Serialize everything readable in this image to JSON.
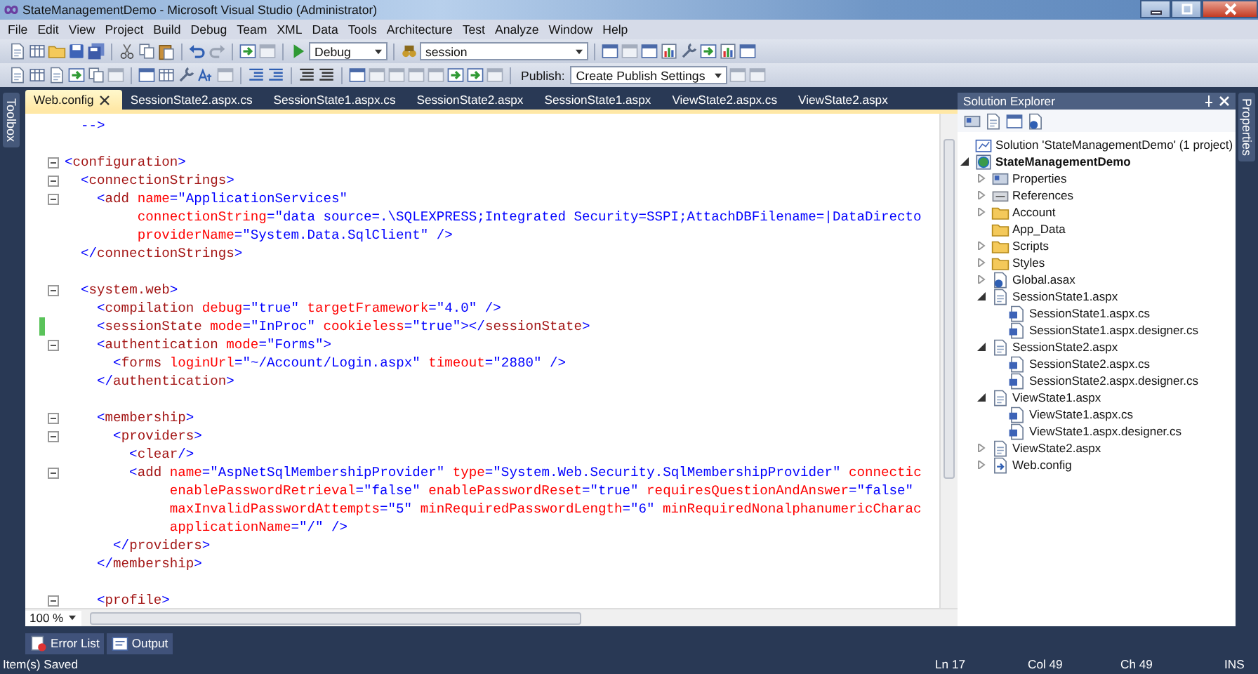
{
  "window": {
    "title": "StateManagementDemo - Microsoft Visual Studio (Administrator)"
  },
  "menu": [
    "File",
    "Edit",
    "View",
    "Project",
    "Build",
    "Debug",
    "Team",
    "XML",
    "Data",
    "Tools",
    "Architecture",
    "Test",
    "Analyze",
    "Window",
    "Help"
  ],
  "toolbar": {
    "configuration": "Debug",
    "search": "session",
    "publish_label": "Publish:",
    "publish_value": "Create Publish Settings"
  },
  "side_tabs": {
    "left": "Toolbox",
    "right": "Properties"
  },
  "doc_tabs": [
    {
      "label": "Web.config",
      "selected": true
    },
    {
      "label": "SessionState2.aspx.cs",
      "selected": false
    },
    {
      "label": "SessionState1.aspx.cs",
      "selected": false
    },
    {
      "label": "SessionState2.aspx",
      "selected": false
    },
    {
      "label": "SessionState1.aspx",
      "selected": false
    },
    {
      "label": "ViewState2.aspx.cs",
      "selected": false
    },
    {
      "label": "ViewState2.aspx",
      "selected": false
    }
  ],
  "code_lines": [
    {
      "fold": false,
      "changed": false,
      "tokens": [
        {
          "kind": "punct",
          "text": "  -->"
        }
      ]
    },
    {
      "fold": false,
      "changed": false
    },
    {
      "fold": true,
      "changed": false,
      "tokens": [
        {
          "kind": "punct",
          "text": "<"
        },
        {
          "kind": "tag",
          "text": "configuration"
        },
        {
          "kind": "punct",
          "text": ">"
        }
      ]
    },
    {
      "fold": true,
      "changed": false,
      "tokens": [
        {
          "kind": "punct",
          "text": "  <"
        },
        {
          "kind": "tag",
          "text": "connectionStrings"
        },
        {
          "kind": "punct",
          "text": ">"
        }
      ]
    },
    {
      "fold": true,
      "changed": false,
      "tokens": [
        {
          "kind": "punct",
          "text": "    <"
        },
        {
          "kind": "tag",
          "text": "add"
        },
        {
          "kind": "attr",
          "text": " name"
        },
        {
          "kind": "value",
          "text": "=\"ApplicationServices\""
        }
      ]
    },
    {
      "fold": false,
      "changed": false,
      "tokens": [
        {
          "kind": "attr",
          "text": "         connectionString"
        },
        {
          "kind": "value",
          "text": "=\"data source=.\\SQLEXPRESS;Integrated Security=SSPI;AttachDBFilename=|DataDirecto"
        }
      ]
    },
    {
      "fold": false,
      "changed": false,
      "tokens": [
        {
          "kind": "attr",
          "text": "         providerName"
        },
        {
          "kind": "value",
          "text": "=\"System.Data.SqlClient\""
        },
        {
          "kind": "punct",
          "text": " />"
        }
      ]
    },
    {
      "fold": false,
      "changed": false,
      "tokens": [
        {
          "kind": "punct",
          "text": "  </"
        },
        {
          "kind": "tag",
          "text": "connectionStrings"
        },
        {
          "kind": "punct",
          "text": ">"
        }
      ]
    },
    {
      "fold": false,
      "changed": false
    },
    {
      "fold": true,
      "changed": false,
      "tokens": [
        {
          "kind": "punct",
          "text": "  <"
        },
        {
          "kind": "tag",
          "text": "system.web"
        },
        {
          "kind": "punct",
          "text": ">"
        }
      ]
    },
    {
      "fold": false,
      "changed": false,
      "tokens": [
        {
          "kind": "punct",
          "text": "    <"
        },
        {
          "kind": "tag",
          "text": "compilation"
        },
        {
          "kind": "attr",
          "text": " debug"
        },
        {
          "kind": "value",
          "text": "=\"true\""
        },
        {
          "kind": "attr",
          "text": " targetFramework"
        },
        {
          "kind": "value",
          "text": "=\"4.0\""
        },
        {
          "kind": "punct",
          "text": " />"
        }
      ]
    },
    {
      "fold": false,
      "changed": true,
      "tokens": [
        {
          "kind": "punct",
          "text": "    <"
        },
        {
          "kind": "tag",
          "text": "sessionState"
        },
        {
          "kind": "attr",
          "text": " mode"
        },
        {
          "kind": "value",
          "text": "=\"InProc\""
        },
        {
          "kind": "attr",
          "text": " cookieless"
        },
        {
          "kind": "value",
          "text": "=\"true\""
        },
        {
          "kind": "punct",
          "text": "></"
        },
        {
          "kind": "tag",
          "text": "sessionState"
        },
        {
          "kind": "punct",
          "text": ">"
        }
      ]
    },
    {
      "fold": true,
      "changed": false,
      "tokens": [
        {
          "kind": "punct",
          "text": "    <"
        },
        {
          "kind": "tag",
          "text": "authentication"
        },
        {
          "kind": "attr",
          "text": " mode"
        },
        {
          "kind": "value",
          "text": "=\"Forms\""
        },
        {
          "kind": "punct",
          "text": ">"
        }
      ]
    },
    {
      "fold": false,
      "changed": false,
      "tokens": [
        {
          "kind": "punct",
          "text": "      <"
        },
        {
          "kind": "tag",
          "text": "forms"
        },
        {
          "kind": "attr",
          "text": " loginUrl"
        },
        {
          "kind": "value",
          "text": "=\"~/Account/Login.aspx\""
        },
        {
          "kind": "attr",
          "text": " timeout"
        },
        {
          "kind": "value",
          "text": "=\"2880\""
        },
        {
          "kind": "punct",
          "text": " />"
        }
      ]
    },
    {
      "fold": false,
      "changed": false,
      "tokens": [
        {
          "kind": "punct",
          "text": "    </"
        },
        {
          "kind": "tag",
          "text": "authentication"
        },
        {
          "kind": "punct",
          "text": ">"
        }
      ]
    },
    {
      "fold": false,
      "changed": false
    },
    {
      "fold": true,
      "changed": false,
      "tokens": [
        {
          "kind": "punct",
          "text": "    <"
        },
        {
          "kind": "tag",
          "text": "membership"
        },
        {
          "kind": "punct",
          "text": ">"
        }
      ]
    },
    {
      "fold": true,
      "changed": false,
      "tokens": [
        {
          "kind": "punct",
          "text": "      <"
        },
        {
          "kind": "tag",
          "text": "providers"
        },
        {
          "kind": "punct",
          "text": ">"
        }
      ]
    },
    {
      "fold": false,
      "changed": false,
      "tokens": [
        {
          "kind": "punct",
          "text": "        <"
        },
        {
          "kind": "tag",
          "text": "clear"
        },
        {
          "kind": "punct",
          "text": "/>"
        }
      ]
    },
    {
      "fold": true,
      "changed": false,
      "tokens": [
        {
          "kind": "punct",
          "text": "        <"
        },
        {
          "kind": "tag",
          "text": "add"
        },
        {
          "kind": "attr",
          "text": " name"
        },
        {
          "kind": "value",
          "text": "=\"AspNetSqlMembershipProvider\""
        },
        {
          "kind": "attr",
          "text": " type"
        },
        {
          "kind": "value",
          "text": "=\"System.Web.Security.SqlMembershipProvider\""
        },
        {
          "kind": "attr",
          "text": " connectic"
        }
      ]
    },
    {
      "fold": false,
      "changed": false,
      "tokens": [
        {
          "kind": "attr",
          "text": "             enablePasswordRetrieval"
        },
        {
          "kind": "value",
          "text": "=\"false\""
        },
        {
          "kind": "attr",
          "text": " enablePasswordReset"
        },
        {
          "kind": "value",
          "text": "=\"true\""
        },
        {
          "kind": "attr",
          "text": " requiresQuestionAndAnswer"
        },
        {
          "kind": "value",
          "text": "=\"false\""
        }
      ]
    },
    {
      "fold": false,
      "changed": false,
      "tokens": [
        {
          "kind": "attr",
          "text": "             maxInvalidPasswordAttempts"
        },
        {
          "kind": "value",
          "text": "=\"5\""
        },
        {
          "kind": "attr",
          "text": " minRequiredPasswordLength"
        },
        {
          "kind": "value",
          "text": "=\"6\""
        },
        {
          "kind": "attr",
          "text": " minRequiredNonalphanumericCharac"
        }
      ]
    },
    {
      "fold": false,
      "changed": false,
      "tokens": [
        {
          "kind": "attr",
          "text": "             applicationName"
        },
        {
          "kind": "value",
          "text": "=\"/\""
        },
        {
          "kind": "punct",
          "text": " />"
        }
      ]
    },
    {
      "fold": false,
      "changed": false,
      "tokens": [
        {
          "kind": "punct",
          "text": "      </"
        },
        {
          "kind": "tag",
          "text": "providers"
        },
        {
          "kind": "punct",
          "text": ">"
        }
      ]
    },
    {
      "fold": false,
      "changed": false,
      "tokens": [
        {
          "kind": "punct",
          "text": "    </"
        },
        {
          "kind": "tag",
          "text": "membership"
        },
        {
          "kind": "punct",
          "text": ">"
        }
      ]
    },
    {
      "fold": false,
      "changed": false
    },
    {
      "fold": true,
      "changed": false,
      "tokens": [
        {
          "kind": "punct",
          "text": "    <"
        },
        {
          "kind": "tag",
          "text": "profile"
        },
        {
          "kind": "punct",
          "text": ">"
        }
      ]
    }
  ],
  "zoom": "100 %",
  "solution_explorer": {
    "title": "Solution Explorer",
    "tree": [
      {
        "label": "Solution 'StateManagementDemo' (1 project)",
        "kind": "solution",
        "children": [
          {
            "label": "StateManagementDemo",
            "kind": "project",
            "expanded": true,
            "children": [
              {
                "label": "Properties",
                "kind": "properties",
                "expanded": false
              },
              {
                "label": "References",
                "kind": "references",
                "expanded": false
              },
              {
                "label": "Account",
                "kind": "folder",
                "expanded": false
              },
              {
                "label": "App_Data",
                "kind": "folder"
              },
              {
                "label": "Scripts",
                "kind": "folder",
                "expanded": false
              },
              {
                "label": "Styles",
                "kind": "folder",
                "expanded": false
              },
              {
                "label": "Global.asax",
                "kind": "global",
                "expanded": false
              },
              {
                "label": "SessionState1.aspx",
                "kind": "page",
                "expanded": true,
                "children": [
                  {
                    "label": "SessionState1.aspx.cs",
                    "kind": "code"
                  },
                  {
                    "label": "SessionState1.aspx.designer.cs",
                    "kind": "code"
                  }
                ]
              },
              {
                "label": "SessionState2.aspx",
                "kind": "page",
                "expanded": true,
                "children": [
                  {
                    "label": "SessionState2.aspx.cs",
                    "kind": "code"
                  },
                  {
                    "label": "SessionState2.aspx.designer.cs",
                    "kind": "code"
                  }
                ]
              },
              {
                "label": "ViewState1.aspx",
                "kind": "page",
                "expanded": true,
                "children": [
                  {
                    "label": "ViewState1.aspx.cs",
                    "kind": "code"
                  },
                  {
                    "label": "ViewState1.aspx.designer.cs",
                    "kind": "code"
                  }
                ]
              },
              {
                "label": "ViewState2.aspx",
                "kind": "page",
                "expanded": false
              },
              {
                "label": "Web.config",
                "kind": "config",
                "expanded": false
              }
            ]
          }
        ]
      }
    ]
  },
  "bottom_tabs": [
    {
      "label": "Error List",
      "kind": "errors"
    },
    {
      "label": "Output",
      "kind": "output"
    }
  ],
  "status_bar": {
    "message": "Item(s) Saved",
    "line": "Ln 17",
    "column": "Col 49",
    "char": "Ch 49",
    "mode": "INS"
  }
}
